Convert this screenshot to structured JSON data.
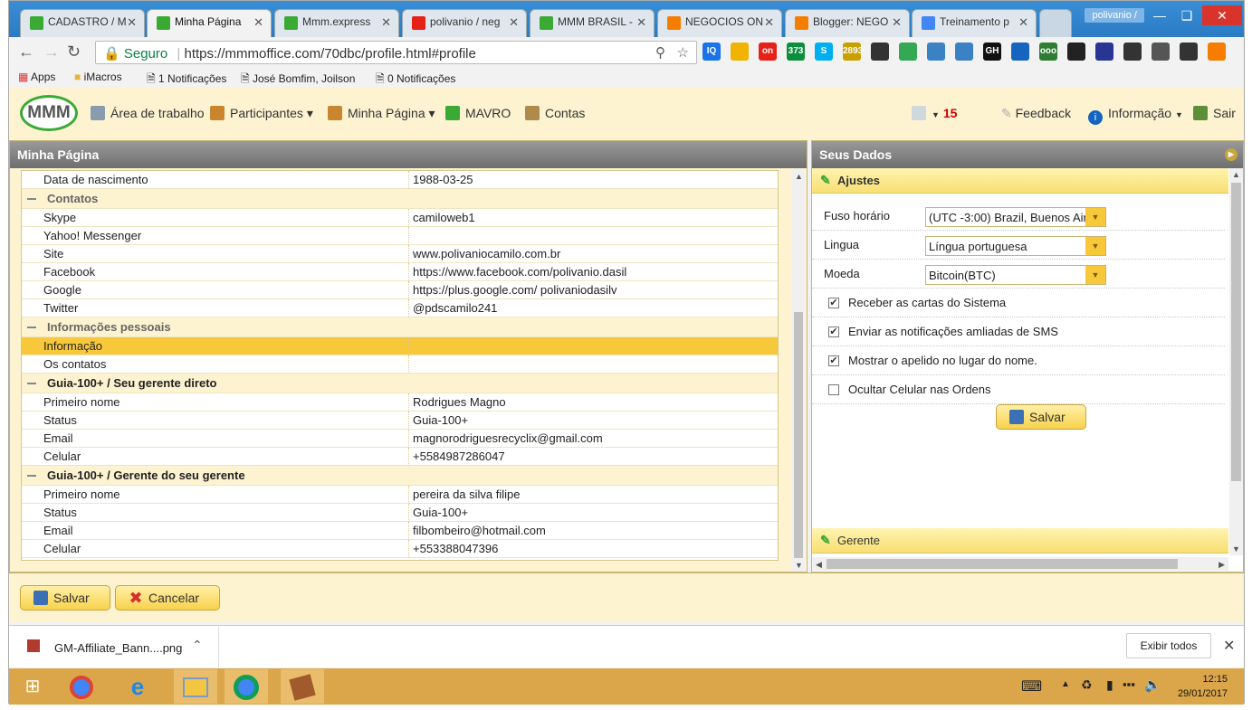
{
  "browser": {
    "tabs": [
      {
        "title": "CADASTRO / M",
        "icon": "mmm-icon",
        "color": "#3aaa35"
      },
      {
        "title": "Minha Página",
        "icon": "mmm-icon",
        "color": "#3aaa35"
      },
      {
        "title": "Mmm.express",
        "icon": "mmm-icon",
        "color": "#3aaa35"
      },
      {
        "title": "polivanio / neg",
        "icon": "youtube-icon",
        "color": "#e62117"
      },
      {
        "title": "MMM BRASIL -",
        "icon": "mmm-icon",
        "color": "#3aaa35"
      },
      {
        "title": "NEGOCIOS ON",
        "icon": "blogger-icon",
        "color": "#f57d00"
      },
      {
        "title": "Blogger: NEGO",
        "icon": "blogger-icon",
        "color": "#f57d00"
      },
      {
        "title": "Treinamento p",
        "icon": "drive-icon",
        "color": "#4285f4"
      }
    ],
    "user": "polivanio /",
    "security_label": "Seguro",
    "url": "https://mmmoffice.com/70dbc/profile.html#profile",
    "bookmarks": [
      "Apps",
      "iMacros",
      "1 Notificações",
      "José Bomfim, Joilson",
      "0 Notificações"
    ],
    "extensions": [
      {
        "name": "iq-icon",
        "label": "IQ",
        "color": "#1a73e8"
      },
      {
        "name": "face-icon",
        "label": "",
        "color": "#f0b400"
      },
      {
        "name": "youtube-ext-icon",
        "label": "on",
        "color": "#e62117"
      },
      {
        "name": "ext-373-icon",
        "label": "373",
        "color": "#0a8f3c"
      },
      {
        "name": "skype-icon",
        "label": "S",
        "color": "#00aff0"
      },
      {
        "name": "ext-2893-icon",
        "label": "2893",
        "color": "#c9a000"
      },
      {
        "name": "clapper-icon",
        "label": "",
        "color": "#333333"
      },
      {
        "name": "chrome-ext-icon",
        "label": "",
        "color": "#34a853"
      },
      {
        "name": "chart-ext-icon",
        "label": "",
        "color": "#3b82c4"
      },
      {
        "name": "window-ext-icon",
        "label": "",
        "color": "#3b82c4"
      },
      {
        "name": "gh-icon",
        "label": "GH",
        "color": "#111111"
      },
      {
        "name": "heart-icon",
        "label": "",
        "color": "#1565c0"
      },
      {
        "name": "ooo-icon",
        "label": "ooo",
        "color": "#2e7d32"
      },
      {
        "name": "bug-icon",
        "label": "",
        "color": "#222222"
      },
      {
        "name": "shield-ext-icon",
        "label": "",
        "color": "#283593"
      },
      {
        "name": "clapper2-icon",
        "label": "",
        "color": "#333333"
      },
      {
        "name": "cast-icon",
        "label": "",
        "color": "#555555"
      },
      {
        "name": "clapper3-icon",
        "label": "",
        "color": "#333333"
      },
      {
        "name": "menu-icon",
        "label": "",
        "color": "#f57d00"
      }
    ]
  },
  "app": {
    "nav": [
      {
        "label": "Área de trabalho",
        "icon": "desktop-icon",
        "dropdown": false
      },
      {
        "label": "Participantes",
        "icon": "people-icon",
        "dropdown": true
      },
      {
        "label": "Minha Página",
        "icon": "user-icon",
        "dropdown": true
      },
      {
        "label": "MAVRO",
        "icon": "mavro-icon",
        "dropdown": false
      },
      {
        "label": "Contas",
        "icon": "accounts-icon",
        "dropdown": false
      }
    ],
    "messages_count": "15",
    "feedback_label": "Feedback",
    "info_label": "Informação",
    "logout_label": "Sair"
  },
  "left_panel": {
    "title": "Minha Página",
    "rows": [
      {
        "type": "item",
        "key": "Data de nascimento",
        "value": "1988-03-25"
      },
      {
        "type": "group",
        "key": "Contatos",
        "light": true
      },
      {
        "type": "item",
        "key": "Skype",
        "value": "camiloweb1"
      },
      {
        "type": "item",
        "key": "Yahoo! Messenger",
        "value": ""
      },
      {
        "type": "item",
        "key": "Site",
        "value": "www.polivaniocamilo.com.br"
      },
      {
        "type": "item",
        "key": "Facebook",
        "value": "https://www.facebook.com/polivanio.dasil"
      },
      {
        "type": "item",
        "key": "Google",
        "value": "https://plus.google.com/ polivaniodasilv"
      },
      {
        "type": "item",
        "key": "Twitter",
        "value": "@pdscamilo241"
      },
      {
        "type": "group",
        "key": "Informações pessoais",
        "light": true
      },
      {
        "type": "item",
        "key": "Informação",
        "value": "",
        "selected": true
      },
      {
        "type": "item",
        "key": "Os contatos",
        "value": ""
      },
      {
        "type": "group",
        "key": "Guia-100+ / Seu gerente direto",
        "light": false
      },
      {
        "type": "item",
        "key": "Primeiro nome",
        "value": "Rodrigues Magno"
      },
      {
        "type": "item",
        "key": "Status",
        "value": "Guia-100+"
      },
      {
        "type": "item",
        "key": "Email",
        "value": "magnorodriguesrecyclix@gmail.com"
      },
      {
        "type": "item",
        "key": "Celular",
        "value": "+5584987286047"
      },
      {
        "type": "group",
        "key": "Guia-100+ / Gerente do seu gerente",
        "light": false
      },
      {
        "type": "item",
        "key": "Primeiro nome",
        "value": "pereira da silva filipe"
      },
      {
        "type": "item",
        "key": "Status",
        "value": "Guia-100+"
      },
      {
        "type": "item",
        "key": "Email",
        "value": "filbombeiro@hotmail.com"
      },
      {
        "type": "item",
        "key": "Celular",
        "value": "+553388047396"
      }
    ]
  },
  "right_panel": {
    "title": "Seus Dados",
    "section_settings": "Ajustes",
    "timezone_label": "Fuso horário",
    "timezone_value": "(UTC -3:00) Brazil, Buenos Air",
    "language_label": "Lingua",
    "language_value": "Língua portuguesa",
    "currency_label": "Moeda",
    "currency_value": "Bitcoin(BTC)",
    "checkboxes": [
      {
        "label": "Receber as cartas do Sistema",
        "checked": true
      },
      {
        "label": "Enviar as notificações amliadas de SMS",
        "checked": true
      },
      {
        "label": "Mostrar o apelido no lugar do nome.",
        "checked": true
      },
      {
        "label": "Ocultar Celular nas Ordens",
        "checked": false
      }
    ],
    "save_label": "Salvar",
    "section_manager": "Gerente"
  },
  "footer": {
    "save_label": "Salvar",
    "cancel_label": "Cancelar"
  },
  "downloads": {
    "file": "GM-Affiliate_Bann....png",
    "show_all": "Exibir todos"
  },
  "taskbar": {
    "time": "12:15",
    "date": "29/01/2017"
  }
}
